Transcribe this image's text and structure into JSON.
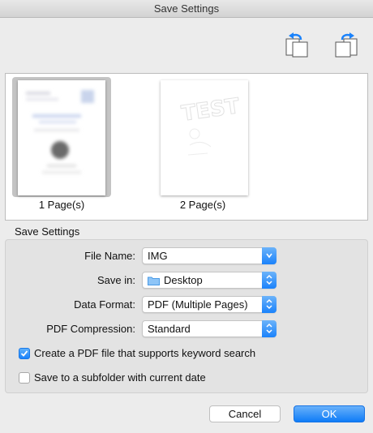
{
  "window": {
    "title": "Save Settings"
  },
  "toolbar": {
    "rotate_left_icon": "rotate-left-icon",
    "rotate_right_icon": "rotate-right-icon"
  },
  "thumbnails": [
    {
      "label": "1 Page(s)",
      "selected": true
    },
    {
      "label": "2 Page(s)",
      "selected": false,
      "watermark": "TEST"
    }
  ],
  "settings": {
    "section_title": "Save Settings",
    "file_name": {
      "label": "File Name:",
      "value": "IMG"
    },
    "save_in": {
      "label": "Save in:",
      "value": "Desktop",
      "icon": "folder-icon"
    },
    "data_format": {
      "label": "Data Format:",
      "value": "PDF (Multiple Pages)"
    },
    "pdf_compression": {
      "label": "PDF Compression:",
      "value": "Standard"
    },
    "keyword_search": {
      "label": "Create a PDF file that supports keyword search",
      "checked": true
    },
    "subfolder": {
      "label": "Save to a subfolder with current date",
      "checked": false
    }
  },
  "buttons": {
    "cancel": "Cancel",
    "ok": "OK"
  },
  "colors": {
    "accent": "#1a82fb",
    "window_bg": "#ececec",
    "panel_bg": "#e3e3e3"
  }
}
